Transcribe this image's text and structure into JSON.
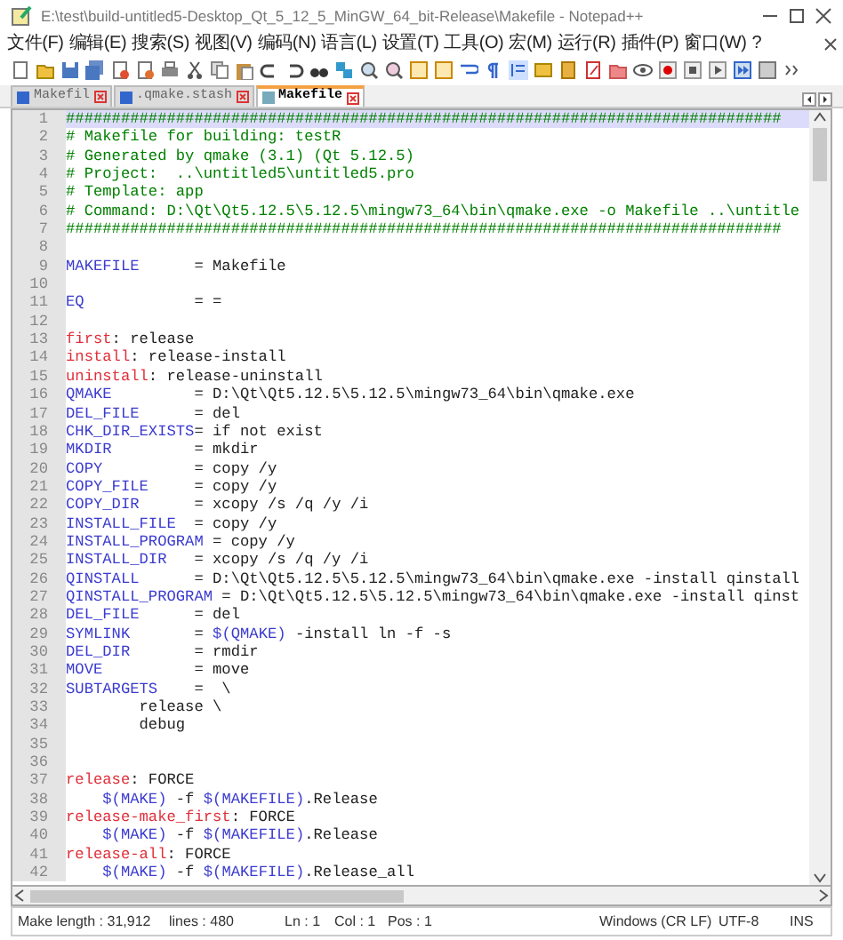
{
  "window": {
    "title": "E:\\test\\build-untitled5-Desktop_Qt_5_12_5_MinGW_64_bit-Release\\Makefile - Notepad++"
  },
  "menu": [
    "文件(F)",
    "编辑(E)",
    "搜索(S)",
    "视图(V)",
    "编码(N)",
    "语言(L)",
    "设置(T)",
    "工具(O)",
    "宏(M)",
    "运行(R)",
    "插件(P)",
    "窗口(W)",
    "?"
  ],
  "tabs": [
    {
      "label": "Makefil",
      "selected": false
    },
    {
      "label": ".qmake.stash",
      "selected": false
    },
    {
      "label": "Makefile",
      "selected": true
    }
  ],
  "lines": [
    {
      "n": "1",
      "current": true,
      "parts": [
        {
          "kind": "comment",
          "text": "##############################################################################"
        }
      ]
    },
    {
      "n": "2",
      "current": false,
      "parts": [
        {
          "kind": "comment",
          "text": "# Makefile for building: testR"
        }
      ]
    },
    {
      "n": "3",
      "current": false,
      "parts": [
        {
          "kind": "comment",
          "text": "# Generated by qmake (3.1) (Qt 5.12.5)"
        }
      ]
    },
    {
      "n": "4",
      "current": false,
      "parts": [
        {
          "kind": "comment",
          "text": "# Project:  ..\\untitled5\\untitled5.pro"
        }
      ]
    },
    {
      "n": "5",
      "current": false,
      "parts": [
        {
          "kind": "comment",
          "text": "# Template: app"
        }
      ]
    },
    {
      "n": "6",
      "current": false,
      "parts": [
        {
          "kind": "comment",
          "text": "# Command: D:\\Qt\\Qt5.12.5\\5.12.5\\mingw73_64\\bin\\qmake.exe -o Makefile ..\\untitle"
        }
      ]
    },
    {
      "n": "7",
      "current": false,
      "parts": [
        {
          "kind": "comment",
          "text": "##############################################################################"
        }
      ]
    },
    {
      "n": "8",
      "current": false
    },
    {
      "n": "9",
      "current": false,
      "parts": [
        {
          "kind": "var",
          "text": "MAKEFILE"
        },
        {
          "kind": "plain",
          "text": "      = Makefile"
        }
      ]
    },
    {
      "n": "10",
      "current": false
    },
    {
      "n": "11",
      "current": false,
      "parts": [
        {
          "kind": "var",
          "text": "EQ"
        },
        {
          "kind": "plain",
          "text": "            = ="
        }
      ]
    },
    {
      "n": "12",
      "current": false
    },
    {
      "n": "13",
      "current": false,
      "parts": [
        {
          "kind": "target",
          "text": "first"
        },
        {
          "kind": "plain",
          "text": ": release"
        }
      ]
    },
    {
      "n": "14",
      "current": false,
      "parts": [
        {
          "kind": "target",
          "text": "install"
        },
        {
          "kind": "plain",
          "text": ": release-install"
        }
      ]
    },
    {
      "n": "15",
      "current": false,
      "parts": [
        {
          "kind": "target",
          "text": "uninstall"
        },
        {
          "kind": "plain",
          "text": ": release-uninstall"
        }
      ]
    },
    {
      "n": "16",
      "current": false,
      "parts": [
        {
          "kind": "var",
          "text": "QMAKE"
        },
        {
          "kind": "plain",
          "text": "         = D:\\Qt\\Qt5.12.5\\5.12.5\\mingw73_64\\bin\\qmake.exe"
        }
      ]
    },
    {
      "n": "17",
      "current": false,
      "parts": [
        {
          "kind": "var",
          "text": "DEL_FILE"
        },
        {
          "kind": "plain",
          "text": "      = del"
        }
      ]
    },
    {
      "n": "18",
      "current": false,
      "parts": [
        {
          "kind": "var",
          "text": "CHK_DIR_EXISTS"
        },
        {
          "kind": "plain",
          "text": "= if not exist"
        }
      ]
    },
    {
      "n": "19",
      "current": false,
      "parts": [
        {
          "kind": "var",
          "text": "MKDIR"
        },
        {
          "kind": "plain",
          "text": "         = mkdir"
        }
      ]
    },
    {
      "n": "20",
      "current": false,
      "parts": [
        {
          "kind": "var",
          "text": "COPY"
        },
        {
          "kind": "plain",
          "text": "          = copy /y"
        }
      ]
    },
    {
      "n": "21",
      "current": false,
      "parts": [
        {
          "kind": "var",
          "text": "COPY_FILE"
        },
        {
          "kind": "plain",
          "text": "     = copy /y"
        }
      ]
    },
    {
      "n": "22",
      "current": false,
      "parts": [
        {
          "kind": "var",
          "text": "COPY_DIR"
        },
        {
          "kind": "plain",
          "text": "      = xcopy /s /q /y /i"
        }
      ]
    },
    {
      "n": "23",
      "current": false,
      "parts": [
        {
          "kind": "var",
          "text": "INSTALL_FILE"
        },
        {
          "kind": "plain",
          "text": "  = copy /y"
        }
      ]
    },
    {
      "n": "24",
      "current": false,
      "parts": [
        {
          "kind": "var",
          "text": "INSTALL_PROGRAM"
        },
        {
          "kind": "plain",
          "text": " = copy /y"
        }
      ]
    },
    {
      "n": "25",
      "current": false,
      "parts": [
        {
          "kind": "var",
          "text": "INSTALL_DIR"
        },
        {
          "kind": "plain",
          "text": "   = xcopy /s /q /y /i"
        }
      ]
    },
    {
      "n": "26",
      "current": false,
      "parts": [
        {
          "kind": "var",
          "text": "QINSTALL"
        },
        {
          "kind": "plain",
          "text": "      = D:\\Qt\\Qt5.12.5\\5.12.5\\mingw73_64\\bin\\qmake.exe -install qinstall"
        }
      ]
    },
    {
      "n": "27",
      "current": false,
      "parts": [
        {
          "kind": "var",
          "text": "QINSTALL_PROGRAM"
        },
        {
          "kind": "plain",
          "text": " = D:\\Qt\\Qt5.12.5\\5.12.5\\mingw73_64\\bin\\qmake.exe -install qinst"
        }
      ]
    },
    {
      "n": "28",
      "current": false,
      "parts": [
        {
          "kind": "var",
          "text": "DEL_FILE"
        },
        {
          "kind": "plain",
          "text": "      = del"
        }
      ]
    },
    {
      "n": "29",
      "current": false,
      "parts": [
        {
          "kind": "var",
          "text": "SYMLINK"
        },
        {
          "kind": "plain",
          "text": "       = "
        },
        {
          "kind": "macro",
          "text": "$(QMAKE)"
        },
        {
          "kind": "plain",
          "text": " -install ln -f -s"
        }
      ]
    },
    {
      "n": "30",
      "current": false,
      "parts": [
        {
          "kind": "var",
          "text": "DEL_DIR"
        },
        {
          "kind": "plain",
          "text": "       = rmdir"
        }
      ]
    },
    {
      "n": "31",
      "current": false,
      "parts": [
        {
          "kind": "var",
          "text": "MOVE"
        },
        {
          "kind": "plain",
          "text": "          = move"
        }
      ]
    },
    {
      "n": "32",
      "current": false,
      "parts": [
        {
          "kind": "var",
          "text": "SUBTARGETS"
        },
        {
          "kind": "plain",
          "text": "    =  \\"
        }
      ]
    },
    {
      "n": "33",
      "current": false,
      "parts": [
        {
          "kind": "plain",
          "text": "        release \\"
        }
      ]
    },
    {
      "n": "34",
      "current": false,
      "parts": [
        {
          "kind": "plain",
          "text": "        debug"
        }
      ]
    },
    {
      "n": "35",
      "current": false
    },
    {
      "n": "36",
      "current": false
    },
    {
      "n": "37",
      "current": false,
      "parts": [
        {
          "kind": "target",
          "text": "release"
        },
        {
          "kind": "plain",
          "text": ": FORCE"
        }
      ]
    },
    {
      "n": "38",
      "current": false,
      "parts": [
        {
          "kind": "macro",
          "text": "    $(MAKE)"
        },
        {
          "kind": "plain",
          "text": " -f "
        },
        {
          "kind": "macro",
          "text": "$(MAKEFILE)"
        },
        {
          "kind": "plain",
          "text": ".Release"
        }
      ]
    },
    {
      "n": "39",
      "current": false,
      "parts": [
        {
          "kind": "target",
          "text": "release-make_first"
        },
        {
          "kind": "plain",
          "text": ": FORCE"
        }
      ]
    },
    {
      "n": "40",
      "current": false,
      "parts": [
        {
          "kind": "macro",
          "text": "    $(MAKE)"
        },
        {
          "kind": "plain",
          "text": " -f "
        },
        {
          "kind": "macro",
          "text": "$(MAKEFILE)"
        },
        {
          "kind": "plain",
          "text": ".Release"
        }
      ]
    },
    {
      "n": "41",
      "current": false,
      "parts": [
        {
          "kind": "target",
          "text": "release-all"
        },
        {
          "kind": "plain",
          "text": ": FORCE"
        }
      ]
    },
    {
      "n": "42",
      "current": false,
      "parts": [
        {
          "kind": "macro",
          "text": "    $(MAKE)"
        },
        {
          "kind": "plain",
          "text": " -f "
        },
        {
          "kind": "macro",
          "text": "$(MAKEFILE)"
        },
        {
          "kind": "plain",
          "text": ".Release_all"
        }
      ]
    }
  ],
  "status_bar": {
    "length": "Make length : 31,912",
    "lines": "lines : 480",
    "ln": "Ln : 1",
    "col": "Col : 1",
    "pos": "Pos : 1",
    "eol": "Windows (CR LF)",
    "encoding": "UTF-8",
    "mode": "INS"
  }
}
